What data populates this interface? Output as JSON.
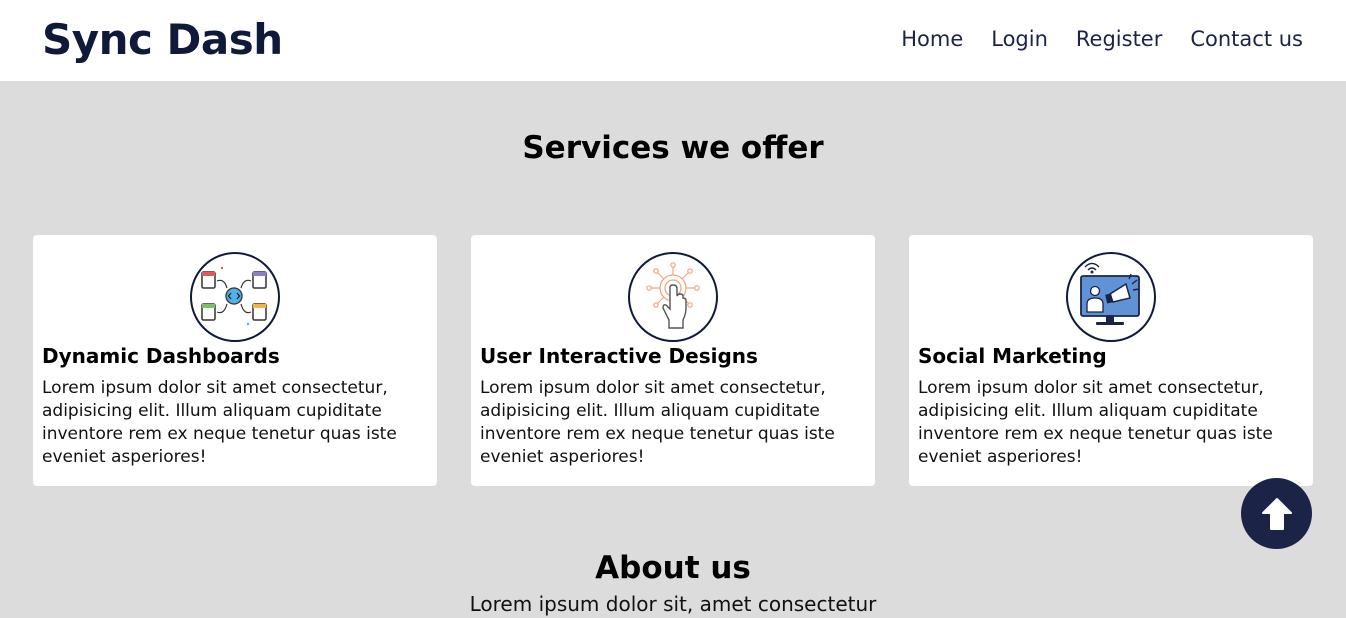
{
  "header": {
    "brand": "Sync Dash",
    "nav": [
      "Home",
      "Login",
      "Register",
      "Contact us"
    ]
  },
  "services": {
    "title": "Services we offer",
    "cards": [
      {
        "icon": "dashboard-flow-icon",
        "title": "Dynamic Dashboards",
        "text": "Lorem ipsum dolor sit amet consectetur, adipisicing elit. Illum aliquam cupiditate inventore rem ex neque tenetur quas iste eveniet asperiores!"
      },
      {
        "icon": "touch-interaction-icon",
        "title": "User Interactive Designs",
        "text": "Lorem ipsum dolor sit amet consectetur, adipisicing elit. Illum aliquam cupiditate inventore rem ex neque tenetur quas iste eveniet asperiores!"
      },
      {
        "icon": "megaphone-monitor-icon",
        "title": "Social Marketing",
        "text": "Lorem ipsum dolor sit amet consectetur, adipisicing elit. Illum aliquam cupiditate inventore rem ex neque tenetur quas iste eveniet asperiores!"
      }
    ]
  },
  "scroll_top": {
    "icon": "arrow-up-icon"
  },
  "about": {
    "title": "About us",
    "subtitle": "Lorem ipsum dolor sit, amet consectetur"
  },
  "colors": {
    "brand": "#0f1a3a",
    "nav_text": "#1b2447",
    "page_bg": "#dcdcdc",
    "card_bg": "#ffffff",
    "scroll_button": "#1b2447"
  }
}
